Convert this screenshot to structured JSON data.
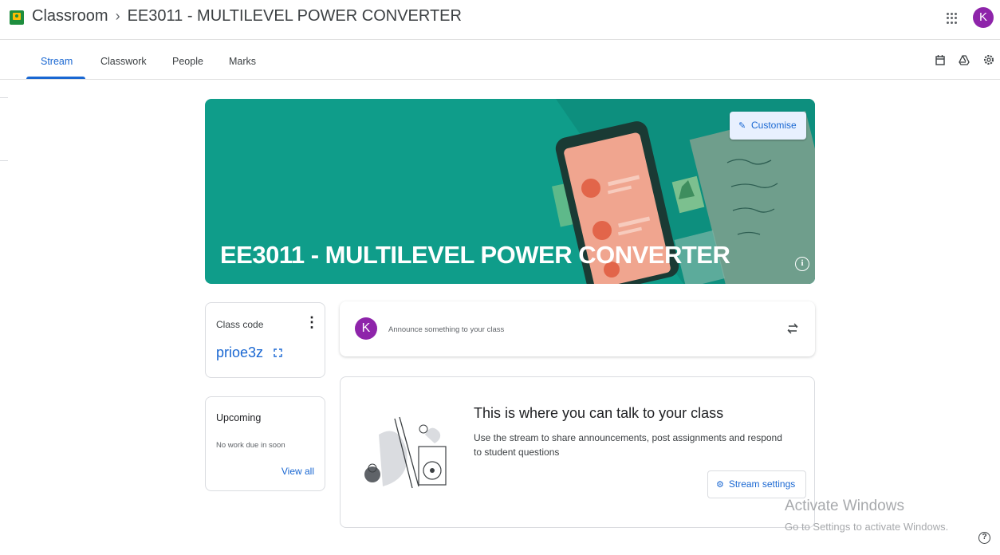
{
  "header": {
    "app_name": "Classroom",
    "separator": "›",
    "course_title": "EE3011 - MULTILEVEL POWER CONVERTER",
    "apps_icon": "apps-grid-icon",
    "user_initial": "K"
  },
  "tabs": [
    {
      "label": "Stream",
      "active": true
    },
    {
      "label": "Classwork",
      "active": false
    },
    {
      "label": "People",
      "active": false
    },
    {
      "label": "Marks",
      "active": false
    }
  ],
  "toolbar_icons": [
    "calendar-icon",
    "drive-icon",
    "settings-icon"
  ],
  "banner": {
    "title": "EE3011 - MULTILEVEL POWER CONVERTER",
    "customise_label": "Customise",
    "background_color": "#0f9d8a"
  },
  "class_code": {
    "label": "Class code",
    "value": "prioe3z"
  },
  "upcoming": {
    "title": "Upcoming",
    "note": "No work due in soon",
    "view_all": "View all"
  },
  "announce": {
    "avatar_initial": "K",
    "placeholder": "Announce something to your class"
  },
  "empty_state": {
    "title": "This is where you can talk to your class",
    "body": "Use the stream to share announcements, post assignments and respond to student questions",
    "button_label": "Stream settings"
  },
  "watermark": {
    "line1": "Activate Windows",
    "line2": "Go to Settings to activate Windows."
  },
  "colors": {
    "accent": "#1967d2",
    "avatar": "#8e24aa",
    "banner": "#0f9d8a"
  }
}
